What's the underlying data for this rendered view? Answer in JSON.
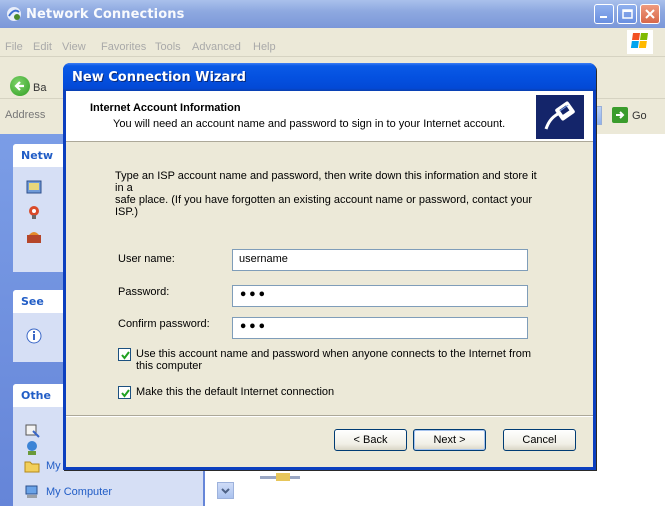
{
  "bg_window": {
    "title": "Network Connections",
    "menu": [
      "File",
      "Edit",
      "View",
      "Favorites",
      "Tools",
      "Advanced",
      "Help"
    ],
    "toolbar": {
      "back_label": "Ba"
    },
    "address": {
      "label": "Address",
      "go_label": "Go"
    },
    "side_panels": [
      {
        "title": "Netw"
      },
      {
        "title": "See"
      },
      {
        "title": "Othe",
        "items": [
          "My Documents",
          "My Computer"
        ]
      }
    ]
  },
  "wizard": {
    "title": "New Connection Wizard",
    "header": {
      "title": "Internet Account Information",
      "subtitle": "You will need an account name and password to sign in to your Internet account."
    },
    "description_line1": "Type an ISP account name and password, then write down this information and store it in a",
    "description_line2": "safe place. (If you have forgotten an existing account name or password, contact your ISP.)",
    "fields": {
      "username": {
        "label": "User name:",
        "value": "username"
      },
      "password": {
        "label": "Password:",
        "value": "•••"
      },
      "confirm": {
        "label": "Confirm password:",
        "value": "•••"
      }
    },
    "checkboxes": {
      "use_account_line1": "Use this account  name and password when anyone connects to the Internet from",
      "use_account_line2": "this computer",
      "use_account_checked": true,
      "default_connection": "Make this the default Internet connection",
      "default_connection_checked": true
    },
    "buttons": {
      "back": "< Back",
      "next": "Next >",
      "cancel": "Cancel"
    }
  },
  "colors": {
    "titlebar_blue": "#0451e0",
    "dialog_face": "#ece9d8",
    "link_blue": "#215dc6"
  }
}
